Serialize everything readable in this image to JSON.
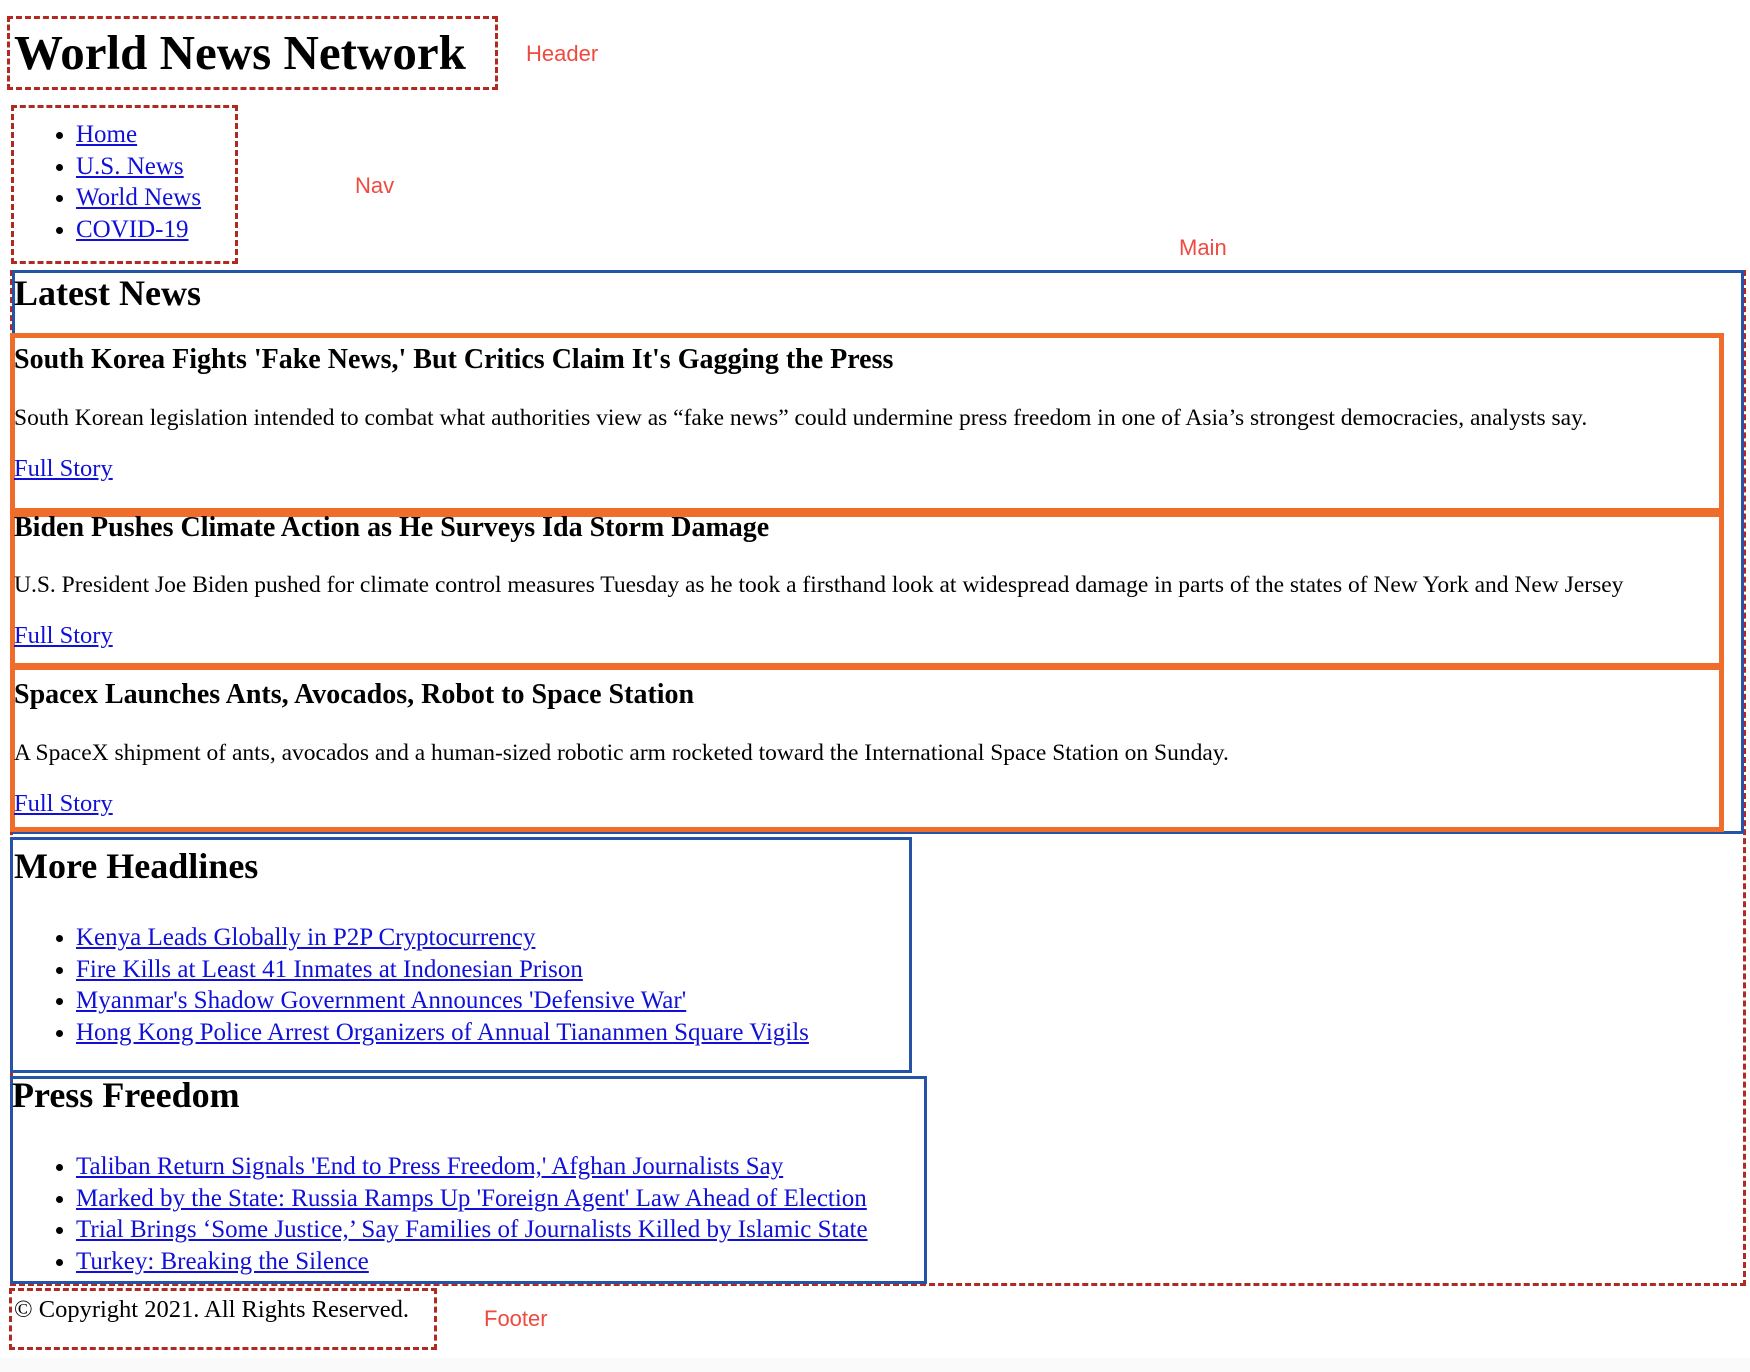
{
  "header": {
    "site_title": "World News Network",
    "annotation": "Header"
  },
  "nav": {
    "annotation": "Nav",
    "links": [
      "Home",
      "U.S. News",
      "World News",
      "COVID-19"
    ]
  },
  "main": {
    "annotation": "Main",
    "latest_news": {
      "heading": "Latest News",
      "articles": [
        {
          "title": "South Korea Fights 'Fake News,' But Critics Claim It's Gagging the Press",
          "summary": "South Korean legislation intended to combat what authorities view as “fake news” could undermine press freedom in one of Asia’s strongest democracies, analysts say.",
          "link": "Full Story"
        },
        {
          "title": "Biden Pushes Climate Action as He Surveys Ida Storm Damage",
          "summary": "U.S. President Joe Biden pushed for climate control measures Tuesday as he took a firsthand look at widespread damage in parts of the states of New York and New Jersey",
          "link": "Full Story"
        },
        {
          "title": "Spacex Launches Ants, Avocados, Robot to Space Station",
          "summary": "A SpaceX shipment of ants, avocados and a human-sized robotic arm rocketed toward the International Space Station on Sunday.",
          "link": "Full Story"
        }
      ]
    },
    "more_headlines": {
      "heading": "More Headlines",
      "links": [
        "Kenya Leads Globally in P2P Cryptocurrency",
        "Fire Kills at Least 41 Inmates at Indonesian Prison",
        "Myanmar's Shadow Government Announces 'Defensive War'",
        "Hong Kong Police Arrest Organizers of Annual Tiananmen Square Vigils"
      ]
    },
    "press_freedom": {
      "heading": "Press Freedom",
      "links": [
        "Taliban Return Signals 'End to Press Freedom,' Afghan Journalists Say",
        "Marked by the State: Russia Ramps Up 'Foreign Agent' Law Ahead of Election",
        "Trial Brings ‘Some Justice,’ Say Families of Journalists Killed by Islamic State",
        "Turkey: Breaking the Silence"
      ]
    }
  },
  "footer": {
    "copyright": "© Copyright 2021. All Rights Reserved.",
    "annotation": "Footer"
  },
  "colors": {
    "semantic_outline": "#b02a22",
    "section_outline": "#2453a7",
    "article_outline": "#ef6c2a",
    "annotation_label": "#ef4a3f",
    "link": "#1010d8"
  }
}
